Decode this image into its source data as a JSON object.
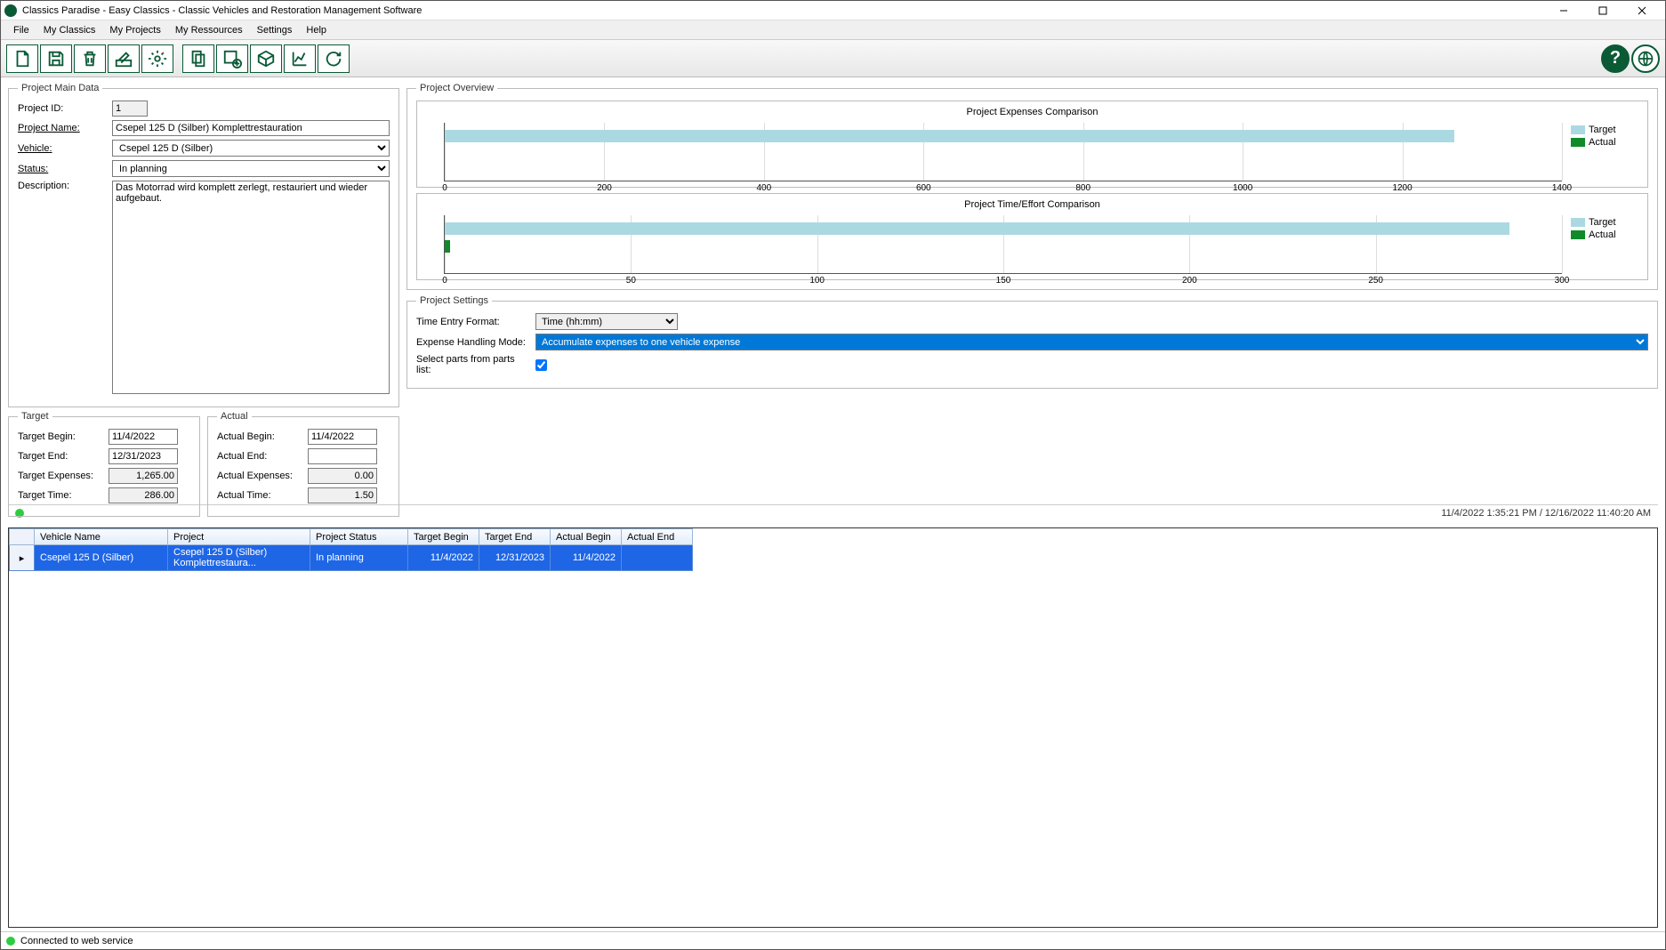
{
  "title": "Classics Paradise - Easy Classics - Classic Vehicles and Restoration Management Software",
  "menu": [
    "File",
    "My Classics",
    "My Projects",
    "My Ressources",
    "Settings",
    "Help"
  ],
  "toolbar_icons": [
    "new",
    "save",
    "delete",
    "edit",
    "gear",
    "copy",
    "add-box",
    "package",
    "chart",
    "refresh"
  ],
  "toolbar_right_icons": [
    "help",
    "globe"
  ],
  "main": {
    "legend": "Project Main Data",
    "id_label": "Project ID:",
    "id_value": "1",
    "name_label": "Project Name:",
    "name_value": "Csepel 125 D (Silber) Komplettrestauration",
    "vehicle_label": "Vehicle:",
    "vehicle_value": "Csepel 125 D (Silber)",
    "status_label": "Status:",
    "status_value": "In planning",
    "desc_label": "Description:",
    "desc_value": "Das Motorrad wird komplett zerlegt, restauriert und wieder aufgebaut."
  },
  "target": {
    "legend": "Target",
    "begin_label": "Target Begin:",
    "begin": "11/4/2022",
    "end_label": "Target End:",
    "end": "12/31/2023",
    "exp_label": "Target Expenses:",
    "exp": "1,265.00",
    "time_label": "Target Time:",
    "time": "286.00"
  },
  "actual": {
    "legend": "Actual",
    "begin_label": "Actual Begin:",
    "begin": "11/4/2022",
    "end_label": "Actual End:",
    "end": "",
    "exp_label": "Actual Expenses:",
    "exp": "0.00",
    "time_label": "Actual Time:",
    "time": "1.50"
  },
  "overview": {
    "legend": "Project Overview",
    "chart1_title": "Project Expenses Comparison",
    "chart2_title": "Project Time/Effort Comparison",
    "legend_target": "Target",
    "legend_actual": "Actual"
  },
  "settings": {
    "legend": "Project Settings",
    "time_format_label": "Time Entry Format:",
    "time_format_value": "Time (hh:mm)",
    "expense_mode_label": "Expense Handling Mode:",
    "expense_mode_value": "Accumulate expenses to one vehicle expense",
    "parts_label": "Select parts from parts list:",
    "parts_checked": true
  },
  "status_time": "11/4/2022 1:35:21 PM / 12/16/2022 11:40:20 AM",
  "grid": {
    "headers": [
      "Vehicle Name",
      "Project",
      "Project Status",
      "Target Begin",
      "Target End",
      "Actual Begin",
      "Actual End"
    ],
    "row": [
      "Csepel 125 D (Silber)",
      "Csepel 125 D (Silber) Komplettrestaura...",
      "In planning",
      "11/4/2022",
      "12/31/2023",
      "11/4/2022",
      ""
    ]
  },
  "footer": "Connected to web service",
  "chart_data": [
    {
      "type": "bar",
      "orientation": "horizontal",
      "title": "Project Expenses Comparison",
      "categories": [
        "Target",
        "Actual"
      ],
      "values": [
        1265,
        0
      ],
      "xlim": [
        0,
        1400
      ],
      "ticks": [
        0,
        200,
        400,
        600,
        800,
        1000,
        1200,
        1400
      ],
      "colors": {
        "Target": "#abd9e2",
        "Actual": "#118a2a"
      }
    },
    {
      "type": "bar",
      "orientation": "horizontal",
      "title": "Project Time/Effort Comparison",
      "categories": [
        "Target",
        "Actual"
      ],
      "values": [
        286,
        1.5
      ],
      "xlim": [
        0,
        300
      ],
      "ticks": [
        0,
        50,
        100,
        150,
        200,
        250,
        300
      ],
      "colors": {
        "Target": "#abd9e2",
        "Actual": "#118a2a"
      }
    }
  ]
}
